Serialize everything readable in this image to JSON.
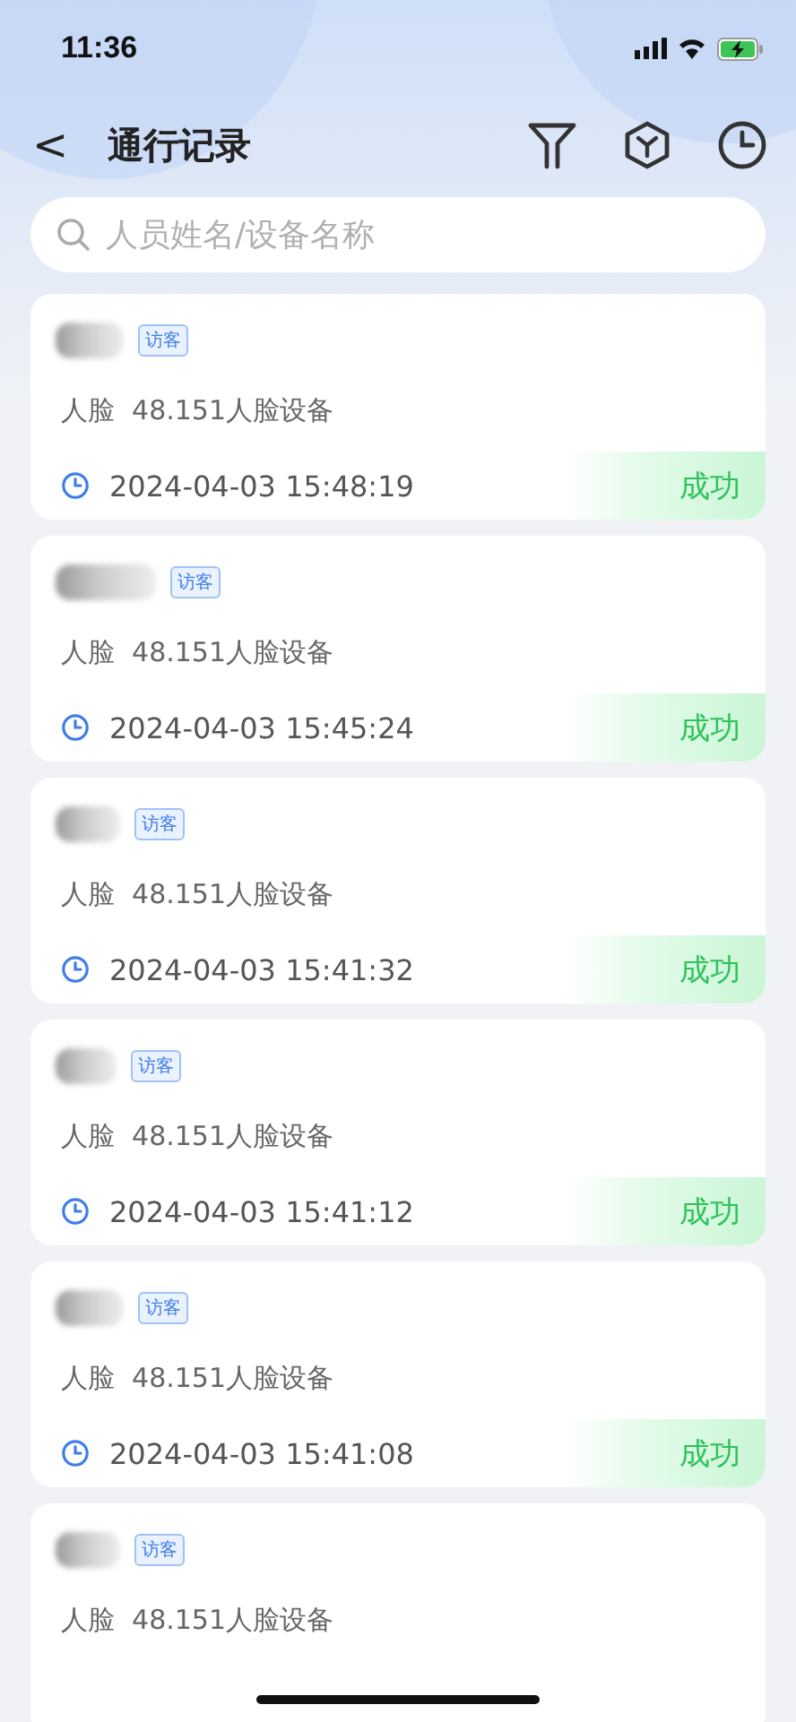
{
  "status_bar": {
    "time": "11:36"
  },
  "header": {
    "title": "通行记录",
    "back": "<"
  },
  "search": {
    "placeholder": "人员姓名/设备名称"
  },
  "records": [
    {
      "tag": "访客",
      "method": "人脸",
      "device": "48.151人脸设备",
      "time": "2024-04-03 15:48:19",
      "result": {
        "text": "成功",
        "kind": "success"
      }
    },
    {
      "tag": "访客",
      "method": "人脸",
      "device": "48.151人脸设备",
      "time": "2024-04-03 15:45:24",
      "result": {
        "text": "成功",
        "kind": "success"
      }
    },
    {
      "tag": "访客",
      "method": "人脸",
      "device": "48.151人脸设备",
      "time": "2024-04-03 15:41:32",
      "result": {
        "text": "成功",
        "kind": "success"
      }
    },
    {
      "tag": "访客",
      "method": "人脸",
      "device": "48.151人脸设备",
      "time": "2024-04-03 15:41:12",
      "result": {
        "text": "成功",
        "kind": "success"
      }
    },
    {
      "tag": "访客",
      "method": "人脸",
      "device": "48.151人脸设备",
      "time": "2024-04-03 15:41:08",
      "result": {
        "text": "成功",
        "kind": "success"
      }
    },
    {
      "tag": "访客",
      "method": "人脸",
      "device": "48.151人脸设备"
    }
  ]
}
